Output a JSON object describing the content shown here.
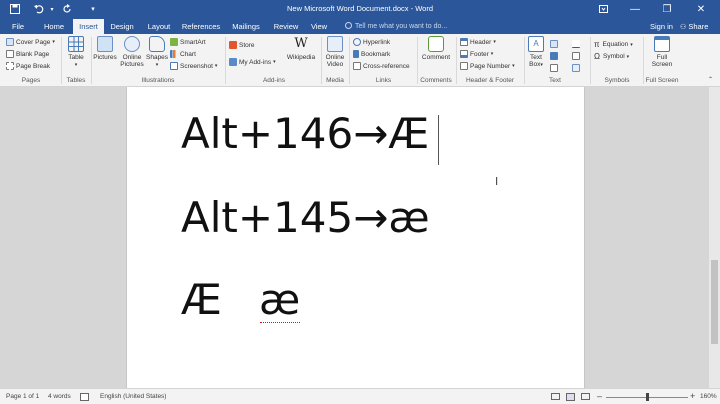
{
  "window": {
    "title": "New Microsoft Word Document.docx - Word",
    "min_glyph": "—",
    "restore_glyph": "❐",
    "close_glyph": "✕"
  },
  "quick_access": {
    "save_icon": "save-icon",
    "undo_icon": "undo-icon",
    "redo_icon": "redo-icon",
    "customize_icon": "customize-qat-icon"
  },
  "tabs": [
    {
      "label": "File"
    },
    {
      "label": "Home"
    },
    {
      "label": "Insert",
      "active": true
    },
    {
      "label": "Design"
    },
    {
      "label": "Layout"
    },
    {
      "label": "References"
    },
    {
      "label": "Mailings"
    },
    {
      "label": "Review"
    },
    {
      "label": "View"
    }
  ],
  "tell_me": {
    "placeholder": "Tell me what you want to do..."
  },
  "account": {
    "signin": "Sign in",
    "share": "Share"
  },
  "ribbon": {
    "pages": {
      "label": "Pages",
      "cover_page": "Cover Page",
      "blank_page": "Blank Page",
      "page_break": "Page Break"
    },
    "tables": {
      "label": "Tables",
      "table": "Table"
    },
    "illustrations": {
      "label": "Illustrations",
      "pictures": "Pictures",
      "online_pictures_1": "Online",
      "online_pictures_2": "Pictures",
      "shapes": "Shapes",
      "smartart": "SmartArt",
      "chart": "Chart",
      "screenshot": "Screenshot"
    },
    "addins": {
      "label": "Add-ins",
      "store": "Store",
      "my_addins": "My Add-ins",
      "wikipedia": "Wikipedia"
    },
    "media": {
      "label": "Media",
      "online_video_1": "Online",
      "online_video_2": "Video"
    },
    "links": {
      "label": "Links",
      "hyperlink": "Hyperlink",
      "bookmark": "Bookmark",
      "cross_reference": "Cross-reference"
    },
    "comments": {
      "label": "Comments",
      "comment": "Comment"
    },
    "header_footer": {
      "label": "Header & Footer",
      "header": "Header",
      "footer": "Footer",
      "page_number": "Page Number"
    },
    "text": {
      "label": "Text",
      "text_box_1": "Text",
      "text_box_2": "Box"
    },
    "symbols": {
      "label": "Symbols",
      "equation": "Equation",
      "symbol": "Symbol"
    },
    "full_screen": {
      "label": "Full Screen",
      "btn_1": "Full",
      "btn_2": "Screen"
    }
  },
  "document": {
    "line1": "Alt+146→Æ",
    "line2": "Alt+145→æ",
    "line3a": "Æ",
    "line3b": "æ"
  },
  "status": {
    "page": "Page 1 of 1",
    "words": "4 words",
    "language": "English (United States)",
    "zoom": "160%"
  }
}
